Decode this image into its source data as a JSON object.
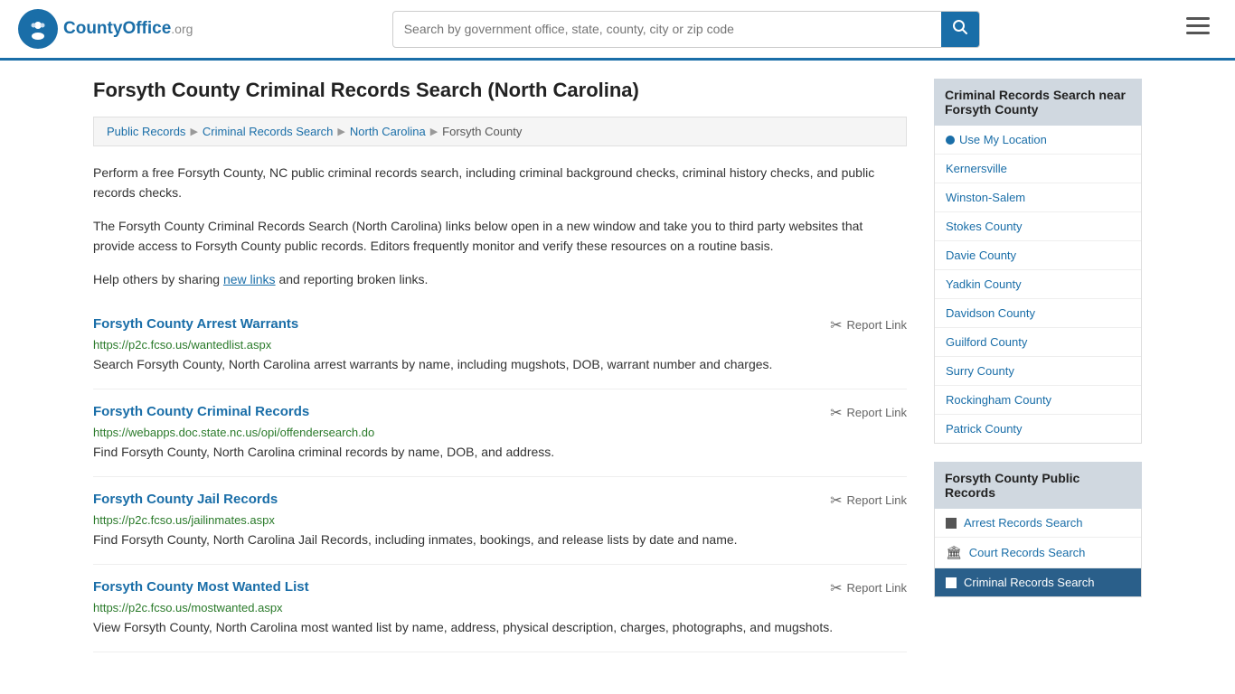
{
  "header": {
    "logo_text": "CountyOffice",
    "logo_suffix": ".org",
    "search_placeholder": "Search by government office, state, county, city or zip code",
    "search_button_label": "🔍"
  },
  "page": {
    "title": "Forsyth County Criminal Records Search (North Carolina)",
    "breadcrumbs": [
      {
        "label": "Public Records",
        "href": "#"
      },
      {
        "label": "Criminal Records Search",
        "href": "#"
      },
      {
        "label": "North Carolina",
        "href": "#"
      },
      {
        "label": "Forsyth County",
        "href": "#"
      }
    ],
    "descriptions": [
      "Perform a free Forsyth County, NC public criminal records search, including criminal background checks, criminal history checks, and public records checks.",
      "The Forsyth County Criminal Records Search (North Carolina) links below open in a new window and take you to third party websites that provide access to Forsyth County public records. Editors frequently monitor and verify these resources on a routine basis.",
      "Help others by sharing new links and reporting broken links."
    ],
    "new_links_text": "new links",
    "results": [
      {
        "title": "Forsyth County Arrest Warrants",
        "url": "https://p2c.fcso.us/wantedlist.aspx",
        "description": "Search Forsyth County, North Carolina arrest warrants by name, including mugshots, DOB, warrant number and charges."
      },
      {
        "title": "Forsyth County Criminal Records",
        "url": "https://webapps.doc.state.nc.us/opi/offendersearch.do",
        "description": "Find Forsyth County, North Carolina criminal records by name, DOB, and address."
      },
      {
        "title": "Forsyth County Jail Records",
        "url": "https://p2c.fcso.us/jailinmates.aspx",
        "description": "Find Forsyth County, North Carolina Jail Records, including inmates, bookings, and release lists by date and name."
      },
      {
        "title": "Forsyth County Most Wanted List",
        "url": "https://p2c.fcso.us/mostwanted.aspx",
        "description": "View Forsyth County, North Carolina most wanted list by name, address, physical description, charges, photographs, and mugshots."
      }
    ],
    "report_link_label": "Report Link"
  },
  "sidebar": {
    "nearby_header": "Criminal Records Search near Forsyth County",
    "use_location_label": "Use My Location",
    "nearby_items": [
      {
        "label": "Kernersville",
        "href": "#"
      },
      {
        "label": "Winston-Salem",
        "href": "#"
      },
      {
        "label": "Stokes County",
        "href": "#"
      },
      {
        "label": "Davie County",
        "href": "#"
      },
      {
        "label": "Yadkin County",
        "href": "#"
      },
      {
        "label": "Davidson County",
        "href": "#"
      },
      {
        "label": "Guilford County",
        "href": "#"
      },
      {
        "label": "Surry County",
        "href": "#"
      },
      {
        "label": "Rockingham County",
        "href": "#"
      },
      {
        "label": "Patrick County",
        "href": "#"
      }
    ],
    "public_records_header": "Forsyth County Public Records",
    "public_records_items": [
      {
        "label": "Arrest Records Search",
        "icon": "square",
        "active": false
      },
      {
        "label": "Court Records Search",
        "icon": "building",
        "active": false
      },
      {
        "label": "Criminal Records Search",
        "icon": "person",
        "active": true
      }
    ]
  }
}
